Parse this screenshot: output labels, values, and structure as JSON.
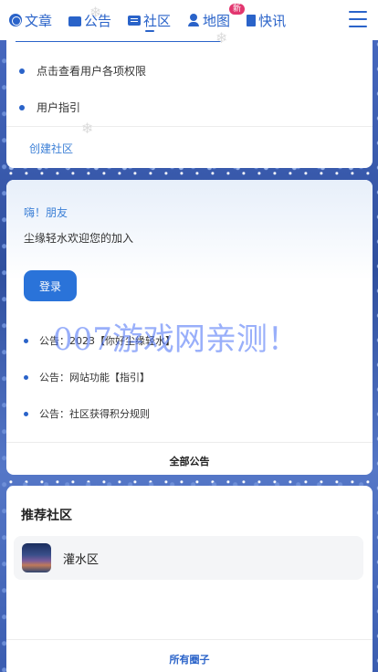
{
  "nav": {
    "items": [
      {
        "label": "文章",
        "icon": "globe-icon"
      },
      {
        "label": "公告",
        "icon": "folder-icon"
      },
      {
        "label": "社区",
        "icon": "chat-icon",
        "active": true
      },
      {
        "label": "地图",
        "icon": "user-icon",
        "badge": "新"
      },
      {
        "label": "快讯",
        "icon": "news-icon"
      }
    ],
    "menu_icon": "hamburger-menu-icon"
  },
  "links_card": {
    "items": [
      "点击查看用户各项权限",
      "用户指引"
    ],
    "create_link": "创建社区"
  },
  "user_card": {
    "greeting": "嗨！朋友",
    "welcome": "尘缘轻水欢迎您的加入",
    "login_label": "登录",
    "notices": [
      "公告：2023【你好尘缘轻水】",
      "公告：网站功能【指引】",
      "公告：社区获得积分规则"
    ],
    "all_notices": "全部公告"
  },
  "recommend": {
    "title": "推荐社区",
    "items": [
      {
        "name": "灌水区"
      }
    ],
    "all_posts": "所有圈子"
  },
  "watermark": "007游戏网亲测！",
  "colors": {
    "accent": "#2a63c9",
    "badge": "#e2366f",
    "button": "#2a73d9"
  }
}
